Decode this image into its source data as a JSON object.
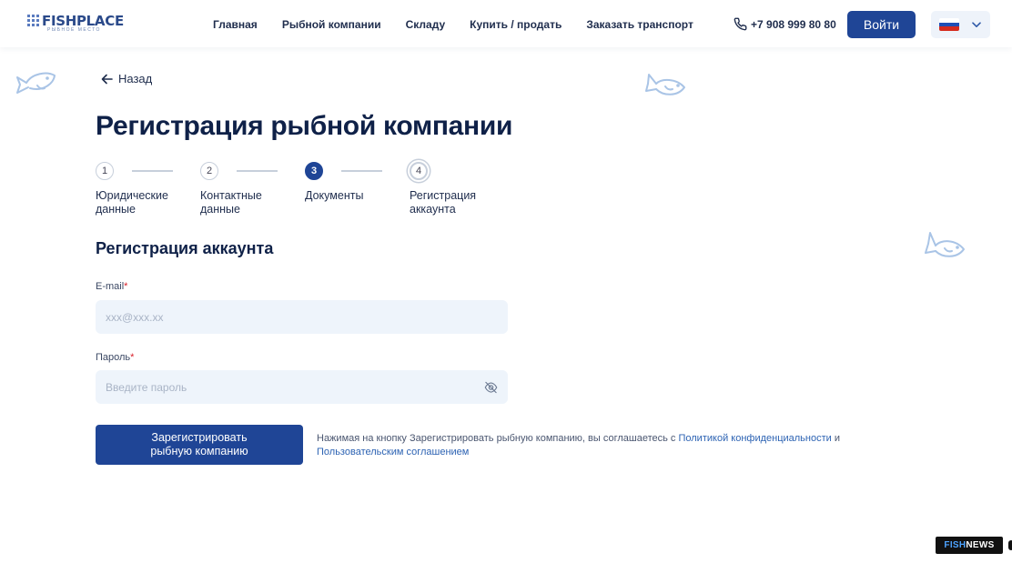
{
  "header": {
    "logo": {
      "name": "FISHPLACE",
      "tagline": "РЫБНОЕ МЕСТО"
    },
    "nav": [
      {
        "label": "Главная"
      },
      {
        "label": "Рыбной компании"
      },
      {
        "label": "Складу"
      },
      {
        "label": "Купить / продать"
      },
      {
        "label": "Заказать транспорт"
      }
    ],
    "phone": "+7 908 999 80 80",
    "login_label": "Войти",
    "language_flag": {
      "colors": [
        "#ffffff",
        "#1f4fb6",
        "#d52b1e"
      ]
    }
  },
  "page": {
    "back_label": "Назад",
    "title": "Регистрация рыбной компании",
    "steps": [
      {
        "number": "1",
        "line1": "Юридические",
        "line2": "данные",
        "state": "done"
      },
      {
        "number": "2",
        "line1": "Контактные",
        "line2": "данные",
        "state": "done"
      },
      {
        "number": "3",
        "line1": "Документы",
        "line2": "",
        "state": "active"
      },
      {
        "number": "4",
        "line1": "Регистрация",
        "line2": "аккаунта",
        "state": "current"
      }
    ],
    "section_title": "Регистрация аккаунта"
  },
  "form": {
    "email": {
      "label": "E-mail",
      "required_mark": "*",
      "placeholder": "xxx@xxx.xx",
      "value": ""
    },
    "password": {
      "label": "Пароль",
      "required_mark": "*",
      "placeholder": "Введите пароль",
      "value": ""
    },
    "submit_line1": "Зарегистрировать",
    "submit_line2": "рыбную компанию",
    "agreement": {
      "text": "Нажимая на кнопку Зарегистрировать рыбную компанию, вы соглашаетесь с ",
      "privacy_link": "Политикой конфиденциальности",
      "and": " и ",
      "terms_link": "Пользовательским соглашением"
    }
  },
  "watermark": {
    "part1": "FISH",
    "part2": "NEWS"
  },
  "colors": {
    "primary": "#1f4596",
    "input_bg": "#eef4fb",
    "link": "#2d63b3",
    "required": "#d8202a",
    "fish_outline": "#a9c4e6"
  }
}
